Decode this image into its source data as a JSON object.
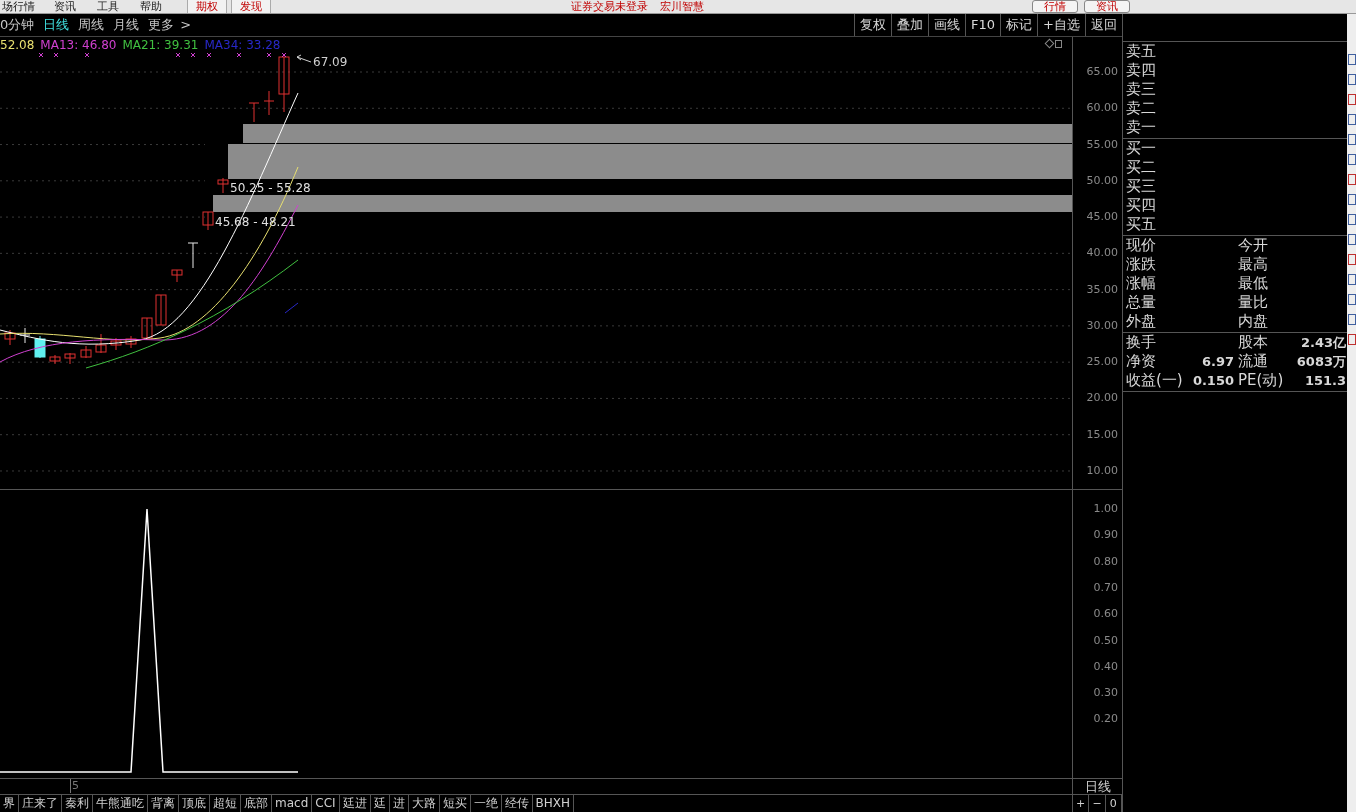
{
  "menu_bar": {
    "items": [
      "场行情",
      "资讯",
      "工具",
      "帮助"
    ],
    "tabs": [
      "期权",
      "发现"
    ],
    "status": "证券交易未登录",
    "account": "宏川智慧",
    "buttons": [
      "行情",
      "资讯"
    ]
  },
  "period_bar": {
    "periods": [
      {
        "label": "0分钟",
        "selected": false
      },
      {
        "label": "日线",
        "selected": true
      },
      {
        "label": "周线",
        "selected": false
      },
      {
        "label": "月线",
        "selected": false
      }
    ],
    "more": "更多",
    "more_arrow": ">",
    "tools": [
      "复权",
      "叠加",
      "画线",
      "F10",
      "标记",
      "+自选",
      "返回"
    ]
  },
  "legend": [
    {
      "text": "52.08",
      "color": "#e8e070"
    },
    {
      "text": "MA13: 46.80",
      "color": "#d040d0"
    },
    {
      "text": "MA21: 39.31",
      "color": "#40c040"
    },
    {
      "text": "MA34: 33.28",
      "color": "#2828c8"
    }
  ],
  "price_labels": {
    "high": "67.09",
    "zone_upper": "50.25 - 55.28",
    "zone_lower": "45.68 - 48.21"
  },
  "price_axis": [
    "65.00",
    "60.00",
    "55.00",
    "50.00",
    "45.00",
    "40.00",
    "35.00",
    "30.00",
    "25.00",
    "20.00",
    "15.00",
    "10.00"
  ],
  "order_book": {
    "sell": [
      "卖五",
      "卖四",
      "卖三",
      "卖二",
      "卖一"
    ],
    "buy": [
      "买一",
      "买二",
      "买三",
      "买四",
      "买五"
    ]
  },
  "quote": [
    {
      "label": "现价",
      "label_2": "今开"
    },
    {
      "label": "涨跌",
      "label_2": "最高"
    },
    {
      "label": "涨幅",
      "label_2": "最低"
    },
    {
      "label": "总量",
      "label_2": "量比"
    },
    {
      "label": "外盘",
      "label_2": "内盘"
    }
  ],
  "stats": [
    {
      "label": "换手",
      "label_2": "股本",
      "value_2": "2.43亿"
    },
    {
      "label": "净资",
      "value": "6.97",
      "label_2": "流通",
      "value_2": "6083万"
    },
    {
      "label": "收益(一)",
      "value": "0.150",
      "label_2": "PE(动)",
      "value_2": "151.3"
    }
  ],
  "indicator_axis": [
    "1.00",
    "0.90",
    "0.80",
    "0.70",
    "0.60",
    "0.50",
    "0.40",
    "0.30",
    "0.20"
  ],
  "x_axis_label": "5",
  "period_label": "日线",
  "zoom_buttons": [
    "+",
    "−",
    "0"
  ],
  "formula_tabs": [
    "界",
    "庄来了",
    "秦利",
    "牛熊通吃",
    "背离",
    "顶底",
    "超短",
    "底部",
    "macd",
    "CCI",
    "廷进",
    "廷",
    "进",
    "大路",
    "短买",
    "一绝",
    "经传",
    "BHXH"
  ]
}
